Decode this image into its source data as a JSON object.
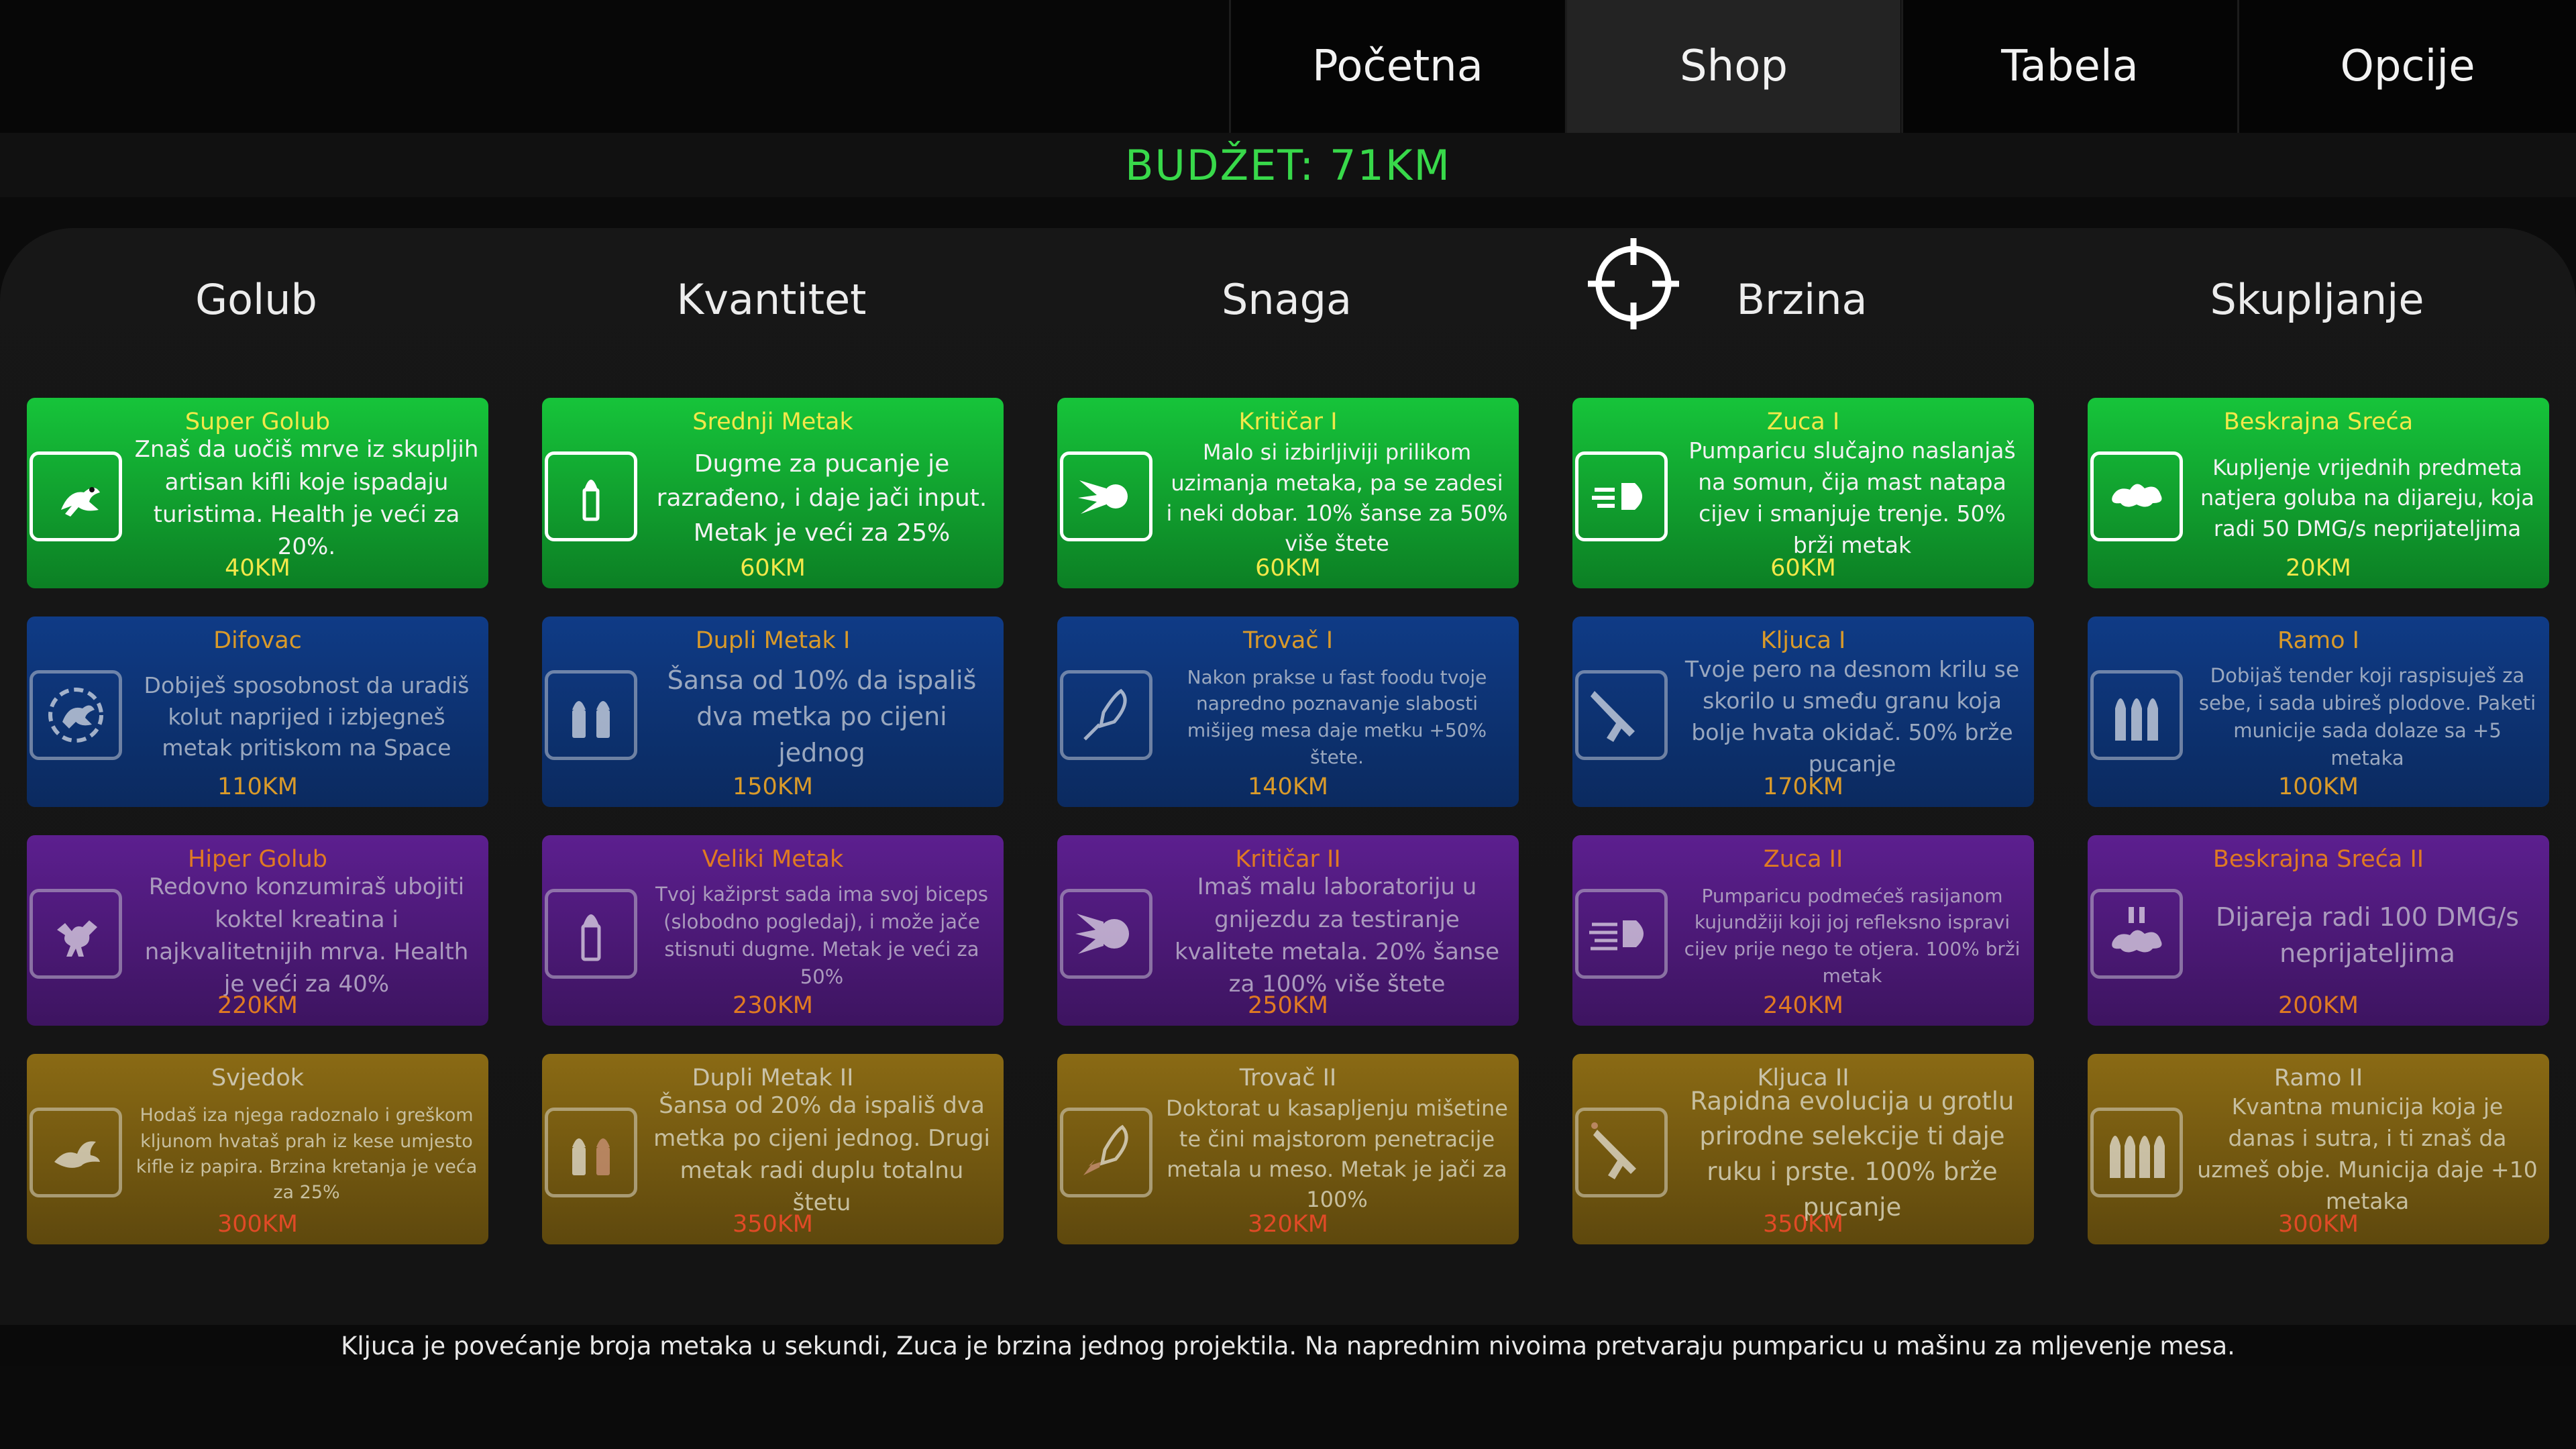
{
  "nav": {
    "tabs": [
      {
        "label": "Početna",
        "active": false
      },
      {
        "label": "Shop",
        "active": true
      },
      {
        "label": "Tabela",
        "active": false
      },
      {
        "label": "Opcije",
        "active": false
      }
    ]
  },
  "budget": "BUDŽET: 71KM",
  "columns": [
    "Golub",
    "Kvantitet",
    "Snaga",
    "Brzina",
    "Skupljanje"
  ],
  "crosshair_icon": "crosshair-icon",
  "colors": {
    "tier1": "#16c43a",
    "tier2": "#0f3b86",
    "tier3": "#5c1f8f",
    "tier4": "#8a6a14",
    "budget": "#38d94a",
    "title_gold": "#f2e84a",
    "price_red": "#e04a26"
  },
  "cards": [
    [
      {
        "title": "Super Golub",
        "desc": "Znaš da uočiš mrve iz skupljih artisan kifli koje ispadaju turistima. Health je veći za 20%.",
        "price": "40KM",
        "icon": "strong-pigeon-icon"
      },
      {
        "title": "Difovac",
        "desc": "Dobiješ sposobnost da uradiš kolut naprijed i izbjegneš metak pritiskom na Space",
        "price": "110KM",
        "icon": "dodge-pigeon-icon"
      },
      {
        "title": "Hiper Golub",
        "desc": "Redovno konzumiraš ubojiti koktel kreatina i najkvalitetnijih mrva. Health je veći za 40%",
        "price": "220KM",
        "icon": "muscle-pigeon-icon"
      },
      {
        "title": "Svjedok",
        "desc": "Hodaš iza njega radoznalo i greškom kljunom hvataš prah iz kese umjesto kifle iz papira. Brzina kretanja je veća za 25%",
        "price": "300KM",
        "icon": "flying-pigeon-icon"
      }
    ],
    [
      {
        "title": "Srednji Metak",
        "desc": "Dugme za pucanje je razrađeno, i daje jači input. Metak je veći za 25%",
        "price": "60KM",
        "icon": "bullet-icon"
      },
      {
        "title": "Dupli Metak I",
        "desc": "Šansa od 10% da ispališ dva metka po cijeni jednog",
        "price": "150KM",
        "icon": "double-bullet-icon"
      },
      {
        "title": "Veliki Metak",
        "desc": "Tvoj kažiprst sada ima svoj biceps (slobodno pogledaj), i može jače stisnuti dugme. Metak je veći za 50%",
        "price": "230KM",
        "icon": "big-bullet-icon"
      },
      {
        "title": "Dupli Metak II",
        "desc": "Šansa od 20% da ispališ dva metka po cijeni jednog. Drugi metak radi duplu totalnu štetu",
        "price": "350KM",
        "icon": "double-bullet-red-icon"
      }
    ],
    [
      {
        "title": "Kritičar I",
        "desc": "Malo si izbirljiviji prilikom uzimanja metaka, pa se zadesi i neki dobar. 10% šanse za 50% više štete",
        "price": "60KM",
        "icon": "comet-icon"
      },
      {
        "title": "Trovač I",
        "desc": "Nakon prakse u fast foodu tvoje napredno poznavanje slabosti mišijeg mesa daje metku +50% štete.",
        "price": "140KM",
        "icon": "rocket-icon"
      },
      {
        "title": "Kritičar II",
        "desc": "Imaš malu laboratoriju u gnijezdu za testiranje kvalitete metala. 20% šanse za 100% više štete",
        "price": "250KM",
        "icon": "comet-big-icon"
      },
      {
        "title": "Trovač II",
        "desc": "Doktorat u kasapljenju mišetine te čini majstorom penetracije metala u meso. Metak je jači za 100%",
        "price": "320KM",
        "icon": "rocket-fire-icon"
      }
    ],
    [
      {
        "title": "Zuca I",
        "desc": "Pumparicu slučajno naslanjaš na somun, čija mast natapa cijev i smanjuje trenje. 50% brži metak",
        "price": "60KM",
        "icon": "speed-bullet-icon"
      },
      {
        "title": "Kljuca I",
        "desc": "Tvoje pero na desnom krilu se skorilo u smeđu granu koja bolje hvata okidač. 50% brže pucanje",
        "price": "170KM",
        "icon": "shotgun-icon"
      },
      {
        "title": "Zuca II",
        "desc": "Pumparicu podmećeš rasijanom kujundžiji koji joj refleksno ispravi cijev prije nego te otjera. 100% brži metak",
        "price": "240KM",
        "icon": "speed-bullet-fast-icon"
      },
      {
        "title": "Kljuca II",
        "desc": "Rapidna evolucija u grotlu prirodne selekcije ti daje ruku i prste. 100% brže pucanje",
        "price": "350KM",
        "icon": "shotgun-fire-icon"
      }
    ],
    [
      {
        "title": "Beskrajna Sreća",
        "desc": "Kupljenje vrijednih predmeta natjera goluba na dijareju, koja radi 50 DMG/s neprijateljima",
        "price": "20KM",
        "icon": "splat-icon"
      },
      {
        "title": "Ramo I",
        "desc": "Dobijaš tender koji raspisuješ za sebe, i sada ubireš plodove. Paketi municije sada dolaze sa +5 metaka",
        "price": "100KM",
        "icon": "ammo-pack-icon"
      },
      {
        "title": "Beskrajna Sreća II",
        "desc": "Dijareja radi 100 DMG/s neprijateljima",
        "price": "200KM",
        "icon": "splat-pause-icon"
      },
      {
        "title": "Ramo II",
        "desc": "Kvantna municija koja je danas i sutra, i ti znaš da uzmeš obje. Municija daje +10 metaka",
        "price": "300KM",
        "icon": "ammo-pack-big-icon"
      }
    ]
  ],
  "footer": "Kljuca je povećanje broja metaka u sekundi, Zuca je brzina jednog projektila. Na naprednim nivoima pretvaraju pumparicu u mašinu za mljevenje mesa."
}
